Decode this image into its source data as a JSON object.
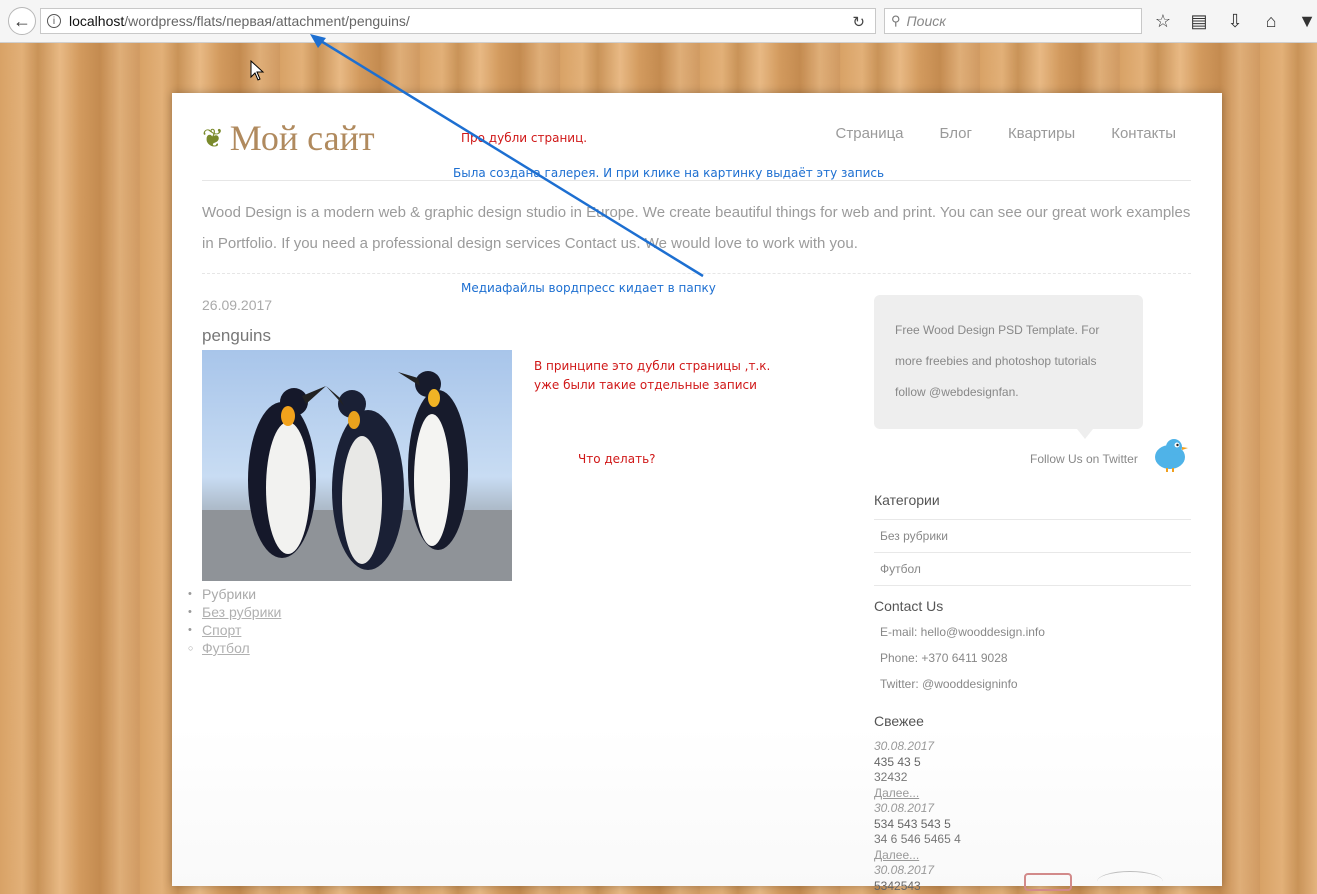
{
  "browser": {
    "url_host": "localhost",
    "url_path": "/wordpress/flats/первая/attachment/penguins/",
    "search_placeholder": "Поиск"
  },
  "site": {
    "logo": "Мой сайт",
    "nav": [
      "Страница",
      "Блог",
      "Квартиры",
      "Контакты"
    ],
    "intro": "Wood Design is a modern web & graphic design studio in Europe. We create beautiful things for web and print. You can see our great work examples in Portfolio. If you need a professional design services Contact us. We would love to work with you."
  },
  "post": {
    "date": "26.09.2017",
    "title": "penguins",
    "terms": [
      "Рубрики",
      "Без рубрики",
      "Спорт",
      "Футбол"
    ]
  },
  "sidebar": {
    "bubble_text": "Free Wood Design PSD Template. For more freebies and photoshop tutorials follow @webdesignfan.",
    "follow": "Follow Us on Twitter",
    "categories_title": "Категории",
    "categories": [
      "Без рубрики",
      "Футбол"
    ],
    "contact_title": "Contact Us",
    "contact_email": "E-mail: hello@wooddesign.info",
    "contact_phone": "Phone: +370 6411 9028",
    "contact_twitter": "Twitter: @wooddesigninfo",
    "recent_title": "Свежее",
    "recent": [
      {
        "date": "30.08.2017",
        "title": "435 43 5",
        "excerpt": "32432",
        "more": "Далее..."
      },
      {
        "date": "30.08.2017",
        "title": "534 543 543 5",
        "excerpt": "34 6 546 5465 4",
        "more": "Далее..."
      },
      {
        "date": "30.08.2017",
        "title": "5342543"
      }
    ]
  },
  "annotations": {
    "a1": "Про дубли страниц.",
    "a2": "Была создана галерея. И при клике на картинку выдаёт эту запись",
    "a3": "Медиафайлы вордпресс кидает в папку",
    "a4_line1": "В принципе это дубли страницы ,т.к.",
    "a4_line2": "уже были такие отдельные записи",
    "a5": "Что делать?"
  }
}
